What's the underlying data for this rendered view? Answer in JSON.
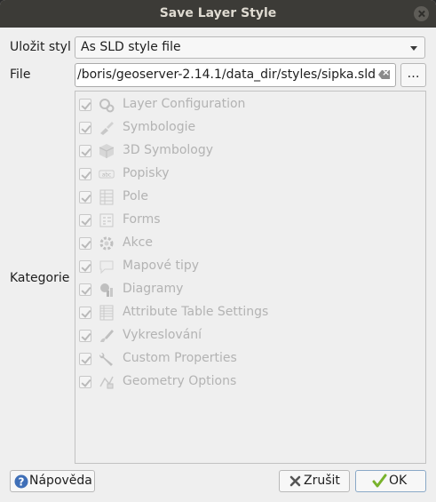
{
  "window": {
    "title": "Save Layer Style"
  },
  "form": {
    "style_label": "Uložit styl",
    "style_value": "As SLD style file",
    "file_label": "File",
    "file_value": "/boris/geoserver-2.14.1/data_dir/styles/sipka.sld",
    "browse_label": "…",
    "categories_label": "Kategorie"
  },
  "categories": [
    {
      "label": "Layer Configuration",
      "icon": "gears-icon",
      "checked": true
    },
    {
      "label": "Symbologie",
      "icon": "paintbrush-icon",
      "checked": true
    },
    {
      "label": "3D Symbology",
      "icon": "cube-icon",
      "checked": true
    },
    {
      "label": "Popisky",
      "icon": "label-abc-icon",
      "checked": true
    },
    {
      "label": "Pole",
      "icon": "fields-table-icon",
      "checked": true
    },
    {
      "label": "Forms",
      "icon": "form-icon",
      "checked": true
    },
    {
      "label": "Akce",
      "icon": "action-gear-icon",
      "checked": true
    },
    {
      "label": "Mapové tipy",
      "icon": "speech-bubble-icon",
      "checked": true
    },
    {
      "label": "Diagramy",
      "icon": "diagram-icon",
      "checked": true
    },
    {
      "label": "Attribute Table Settings",
      "icon": "attribute-table-icon",
      "checked": true
    },
    {
      "label": "Vykreslování",
      "icon": "rendering-brush-icon",
      "checked": true
    },
    {
      "label": "Custom Properties",
      "icon": "wrench-icon",
      "checked": true
    },
    {
      "label": "Geometry Options",
      "icon": "geometry-icon",
      "checked": true
    }
  ],
  "buttons": {
    "help": "Nápověda",
    "cancel": "Zrušit",
    "ok": "OK"
  },
  "colors": {
    "titlebar": "#3c3b37",
    "disabled_text": "#b3b3b3",
    "ok_check": "#78b22b",
    "help_icon": "#3f6fb7"
  }
}
